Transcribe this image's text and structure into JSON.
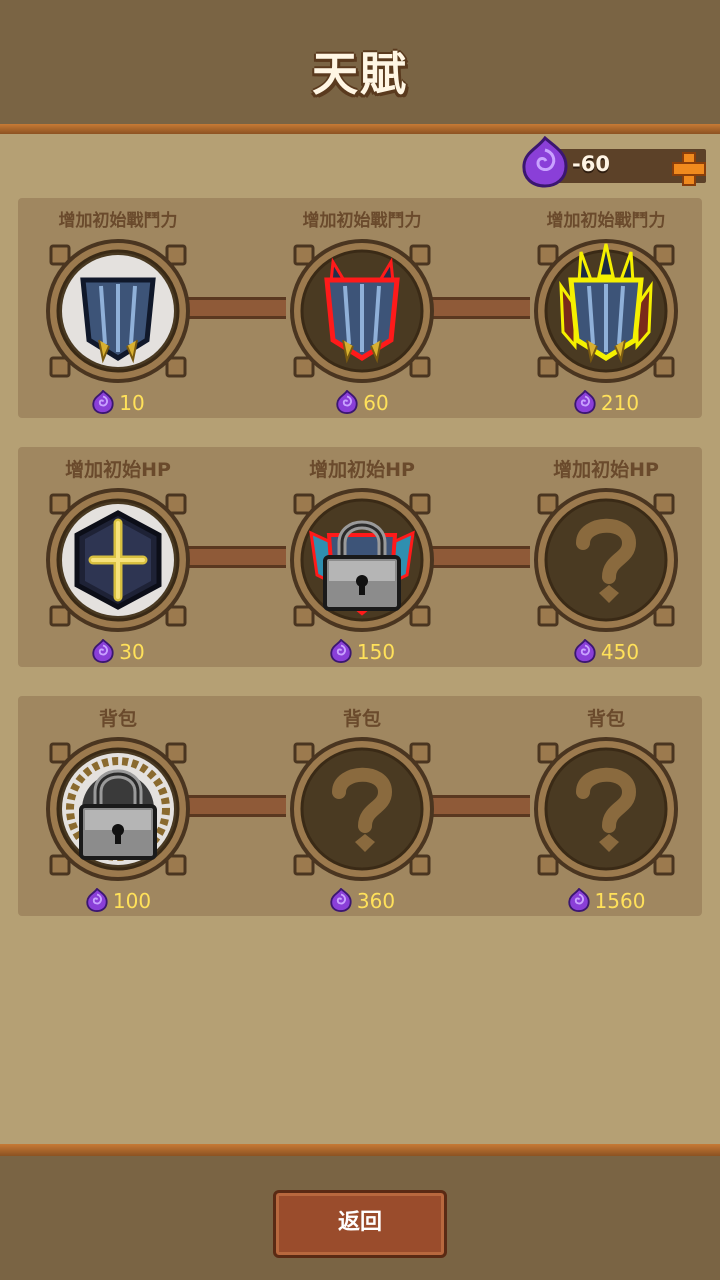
{
  "header": {
    "title": "天賦"
  },
  "currency": {
    "value": "-60",
    "icon": "purple-gem-icon",
    "add_icon": "plus-icon"
  },
  "rows": [
    {
      "talents": [
        {
          "label": "增加初始戰鬥力",
          "cost": "10",
          "state": "unlocked",
          "icon": "shield-tier1-icon",
          "glow": "#ffffff"
        },
        {
          "label": "增加初始戰鬥力",
          "cost": "60",
          "state": "unlocked",
          "icon": "shield-tier2-icon",
          "glow": "#ff1a1a"
        },
        {
          "label": "增加初始戰鬥力",
          "cost": "210",
          "state": "unlocked",
          "icon": "shield-tier3-icon",
          "glow": "#f5f000"
        }
      ]
    },
    {
      "talents": [
        {
          "label": "增加初始HP",
          "cost": "30",
          "state": "unlocked",
          "icon": "cross-shield-icon",
          "glow": "#ffffff"
        },
        {
          "label": "增加初始HP",
          "cost": "150",
          "state": "locked",
          "icon": "winged-shield-icon",
          "glow": "#ff1a1a"
        },
        {
          "label": "增加初始HP",
          "cost": "450",
          "state": "unknown",
          "icon": "question-mark-icon"
        }
      ]
    },
    {
      "talents": [
        {
          "label": "背包",
          "cost": "100",
          "state": "locked",
          "icon": "wreath-badge-icon",
          "glow": "#ffffff"
        },
        {
          "label": "背包",
          "cost": "360",
          "state": "unknown",
          "icon": "question-mark-icon"
        },
        {
          "label": "背包",
          "cost": "1560",
          "state": "unknown",
          "icon": "question-mark-icon"
        }
      ]
    }
  ],
  "footer": {
    "back_label": "返回"
  }
}
